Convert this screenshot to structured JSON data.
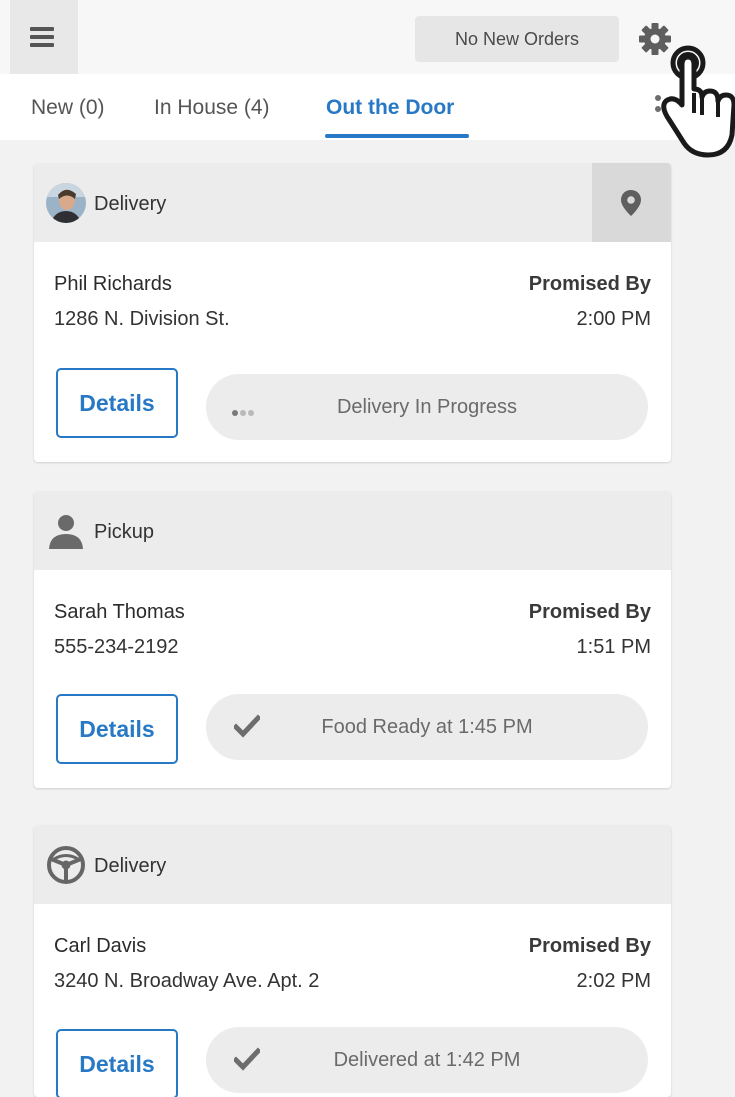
{
  "header": {
    "status_label": "No New Orders",
    "menu_icon": "hamburger-menu-icon",
    "settings_icon": "gear-icon"
  },
  "tabs": [
    {
      "label": "New (0)",
      "active": false
    },
    {
      "label": "In House (4)",
      "active": false
    },
    {
      "label": "Out the Door",
      "active": true
    }
  ],
  "colors": {
    "accent": "#2879c5",
    "header_bg": "#ececec",
    "page_bg": "#f2f2f2"
  },
  "orders": [
    {
      "type": "Delivery",
      "type_icon": "driver-avatar",
      "show_map": true,
      "customer": "Phil Richards",
      "line2": "1286 N. Division St.",
      "promised_label": "Promised By",
      "promised_time": "2:00 PM",
      "details_label": "Details",
      "status_icon": "progress-dots-icon",
      "status_text": "Delivery In Progress"
    },
    {
      "type": "Pickup",
      "type_icon": "person-icon",
      "show_map": false,
      "customer": "Sarah Thomas",
      "line2": "555-234-2192",
      "promised_label": "Promised By",
      "promised_time": "1:51 PM",
      "details_label": "Details",
      "status_icon": "checkmark-icon",
      "status_text": "Food Ready at 1:45 PM"
    },
    {
      "type": "Delivery",
      "type_icon": "steering-wheel-icon",
      "show_map": false,
      "customer": "Carl Davis",
      "line2": "3240 N. Broadway Ave. Apt. 2",
      "promised_label": "Promised By",
      "promised_time": "2:02 PM",
      "details_label": "Details",
      "status_icon": "checkmark-icon",
      "status_text": "Delivered at 1:42 PM"
    }
  ]
}
